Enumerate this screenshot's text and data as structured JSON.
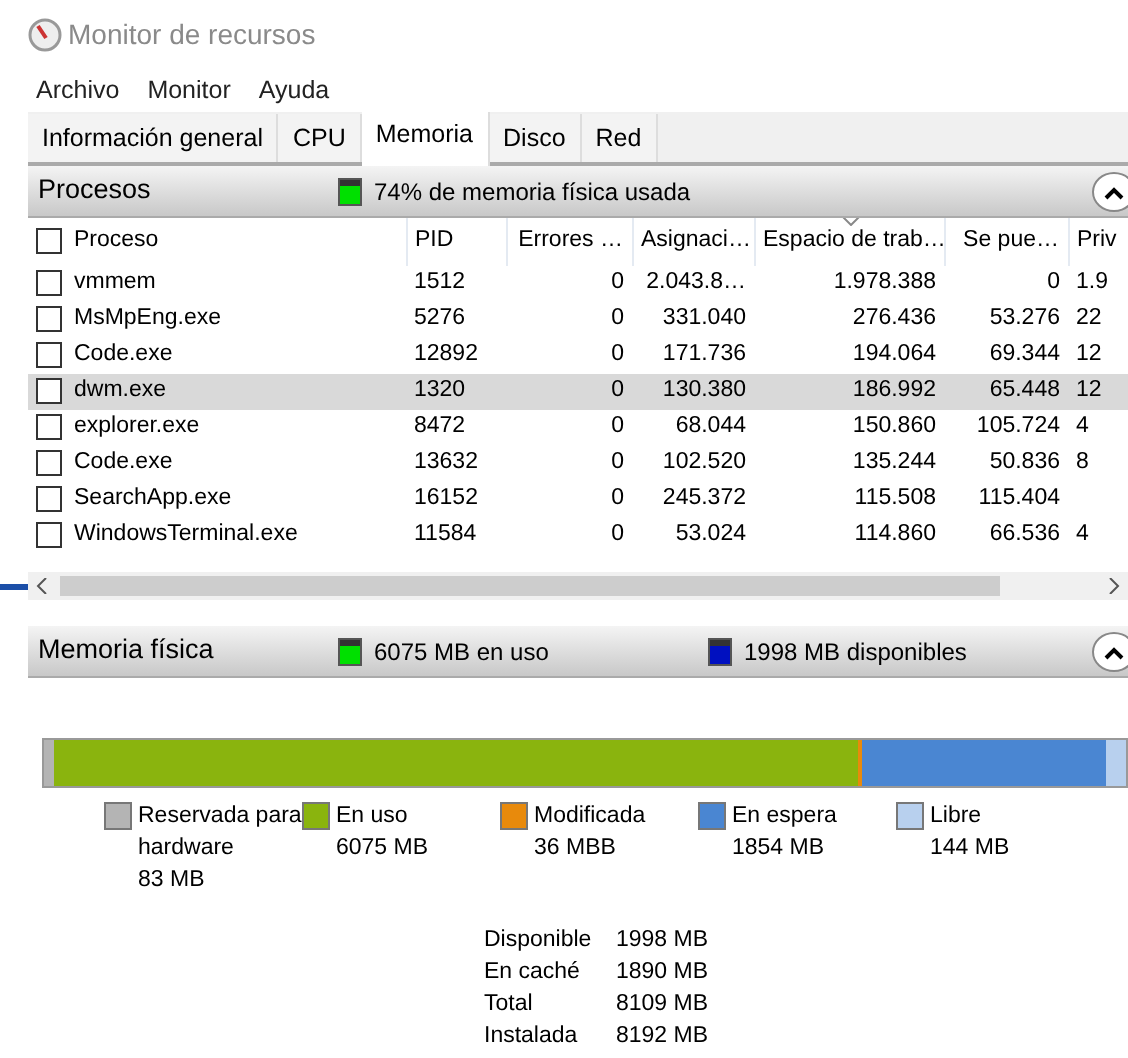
{
  "window": {
    "title": "Monitor de recursos"
  },
  "menu": [
    "Archivo",
    "Monitor",
    "Ayuda"
  ],
  "tabs": [
    {
      "label": "Información general",
      "selected": false
    },
    {
      "label": "CPU",
      "selected": false
    },
    {
      "label": "Memoria",
      "selected": true
    },
    {
      "label": "Disco",
      "selected": false
    },
    {
      "label": "Red",
      "selected": false
    }
  ],
  "processes": {
    "title": "Procesos",
    "expanded": true,
    "status": "74% de memoria física usada",
    "columns": [
      {
        "label": "Proceso",
        "sorted": false
      },
      {
        "label": "PID",
        "sorted": false
      },
      {
        "label": "Errores …",
        "sorted": false
      },
      {
        "label": "Asignaci…",
        "sorted": false
      },
      {
        "label": "Espacio de trab…",
        "sorted": true
      },
      {
        "label": "Se pue…",
        "sorted": false
      },
      {
        "label": "Priv",
        "sorted": false
      }
    ],
    "header_checked": false,
    "rows": [
      {
        "cells": [
          "vmmem",
          "1512",
          "0",
          "2.043.8…",
          "1.978.388",
          "0",
          "1.9"
        ],
        "checked": false,
        "selected": false
      },
      {
        "cells": [
          "MsMpEng.exe",
          "5276",
          "0",
          "331.040",
          "276.436",
          "53.276",
          "22"
        ],
        "checked": false,
        "selected": false
      },
      {
        "cells": [
          "Code.exe",
          "12892",
          "0",
          "171.736",
          "194.064",
          "69.344",
          "12"
        ],
        "checked": false,
        "selected": false
      },
      {
        "cells": [
          "dwm.exe",
          "1320",
          "0",
          "130.380",
          "186.992",
          "65.448",
          "12"
        ],
        "checked": false,
        "selected": true
      },
      {
        "cells": [
          "explorer.exe",
          "8472",
          "0",
          "68.044",
          "150.860",
          "105.724",
          "4"
        ],
        "checked": false,
        "selected": false
      },
      {
        "cells": [
          "Code.exe",
          "13632",
          "0",
          "102.520",
          "135.244",
          "50.836",
          "8"
        ],
        "checked": false,
        "selected": false
      },
      {
        "cells": [
          "SearchApp.exe",
          "16152",
          "0",
          "245.372",
          "115.508",
          "115.404"
        ],
        "checked": false,
        "selected": false
      },
      {
        "cells": [
          "WindowsTerminal.exe",
          "11584",
          "0",
          "53.024",
          "114.860",
          "66.536",
          "4"
        ],
        "checked": false,
        "selected": false
      }
    ]
  },
  "physical_memory": {
    "title": "Memoria física",
    "expanded": true,
    "in_use": "6075 MB en uso",
    "available": "1998 MB disponibles",
    "legend": [
      {
        "label": "Reservada para hardware",
        "value": "83 MB",
        "color": "#b4b4b4"
      },
      {
        "label": "En uso",
        "value": "6075 MB",
        "color": "#8ab40e"
      },
      {
        "label": "Modificada",
        "value": "36 MBB",
        "color": "#e88a0c"
      },
      {
        "label": "En espera",
        "value": "1854 MB",
        "color": "#4a86d2"
      },
      {
        "label": "Libre",
        "value": "144 MB",
        "color": "#b8d0ee"
      }
    ],
    "stats": [
      {
        "label": "Disponible",
        "value": "1998 MB"
      },
      {
        "label": "En caché",
        "value": "1890 MB"
      },
      {
        "label": "Total",
        "value": "8109 MB"
      },
      {
        "label": "Instalada",
        "value": "8192 MB"
      }
    ]
  }
}
